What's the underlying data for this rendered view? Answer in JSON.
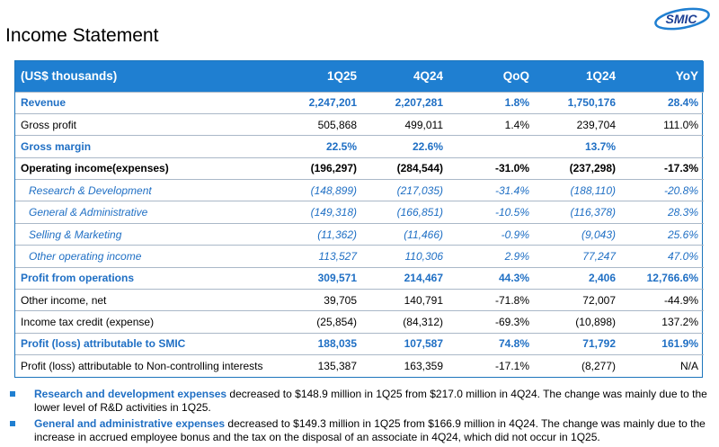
{
  "page_title": "Income Statement",
  "logo_text": "SMIC",
  "brand_color": "#1f7fd1",
  "table": {
    "headers": [
      "(US$ thousands)",
      "1Q25",
      "4Q24",
      "QoQ",
      "1Q24",
      "YoY"
    ],
    "rows": [
      {
        "style": "blue",
        "cells": [
          "Revenue",
          "2,247,201",
          "2,207,281",
          "1.8%",
          "1,750,176",
          "28.4%"
        ]
      },
      {
        "style": "plain",
        "cells": [
          "Gross profit",
          "505,868",
          "499,011",
          "1.4%",
          "239,704",
          "111.0%"
        ]
      },
      {
        "style": "blue",
        "cells": [
          "Gross margin",
          "22.5%",
          "22.6%",
          "",
          "13.7%",
          ""
        ]
      },
      {
        "style": "bold",
        "cells": [
          "Operating income(expenses)",
          "(196,297)",
          "(284,544)",
          "-31.0%",
          "(237,298)",
          "-17.3%"
        ]
      },
      {
        "style": "sub",
        "cells": [
          "Research & Development",
          "(148,899)",
          "(217,035)",
          "-31.4%",
          "(188,110)",
          "-20.8%"
        ]
      },
      {
        "style": "sub",
        "cells": [
          "General & Administrative",
          "(149,318)",
          "(166,851)",
          "-10.5%",
          "(116,378)",
          "28.3%"
        ]
      },
      {
        "style": "sub",
        "cells": [
          "Selling & Marketing",
          "(11,362)",
          "(11,466)",
          "-0.9%",
          "(9,043)",
          "25.6%"
        ]
      },
      {
        "style": "sub",
        "cells": [
          "Other operating income",
          "113,527",
          "110,306",
          "2.9%",
          "77,247",
          "47.0%"
        ]
      },
      {
        "style": "blue",
        "cells": [
          "Profit from operations",
          "309,571",
          "214,467",
          "44.3%",
          "2,406",
          "12,766.6%"
        ]
      },
      {
        "style": "plain",
        "cells": [
          "Other income, net",
          "39,705",
          "140,791",
          "-71.8%",
          "72,007",
          "-44.9%"
        ]
      },
      {
        "style": "plain",
        "cells": [
          "Income tax credit (expense)",
          "(25,854)",
          "(84,312)",
          "-69.3%",
          "(10,898)",
          "137.2%"
        ]
      },
      {
        "style": "blue",
        "cells": [
          "Profit (loss) attributable to SMIC",
          "188,035",
          "107,587",
          "74.8%",
          "71,792",
          "161.9%"
        ]
      },
      {
        "style": "plain",
        "cells": [
          "Profit (loss) attributable to Non-controlling interests",
          "135,387",
          "163,359",
          "-17.1%",
          "(8,277)",
          "N/A"
        ]
      }
    ]
  },
  "bullets": [
    {
      "highlight": "Research and development expenses",
      "text": " decreased to $148.9 million in 1Q25 from $217.0 million in 4Q24. The change was mainly due to the lower level of R&D activities in 1Q25."
    },
    {
      "highlight": "General and administrative expenses",
      "text": " decreased to $149.3 million in 1Q25 from $166.9 million in 4Q24. The change was mainly due to the increase in accrued employee bonus and the tax on the disposal of an associate in 4Q24, which did not occur in 1Q25."
    }
  ]
}
